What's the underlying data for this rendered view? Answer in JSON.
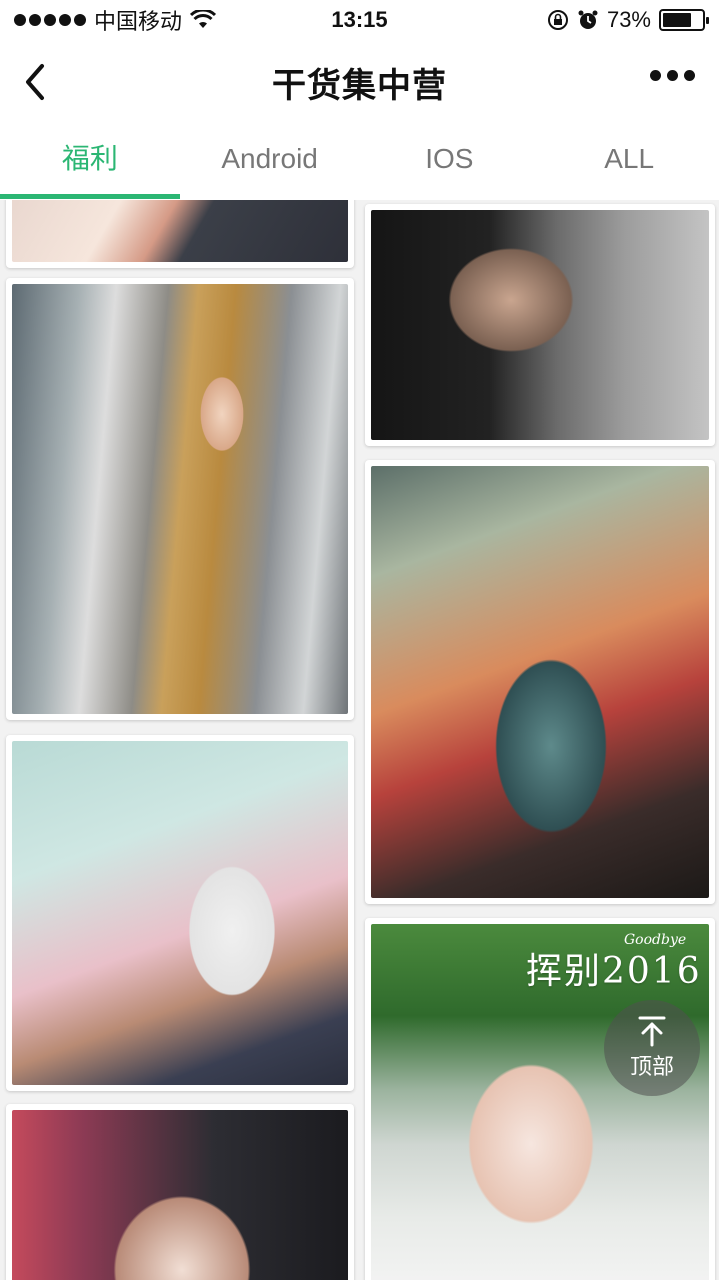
{
  "status_bar": {
    "carrier": "中国移动",
    "time": "13:15",
    "battery_percent": "73%",
    "battery_level": 0.73
  },
  "header": {
    "title": "干货集中营"
  },
  "tabs": [
    {
      "label": "福利",
      "active": true
    },
    {
      "label": "Android",
      "active": false
    },
    {
      "label": "IOS",
      "active": false
    },
    {
      "label": "ALL",
      "active": false
    }
  ],
  "feed": {
    "overlay_text": "挥别2016",
    "overlay_sub": "Goodbye"
  },
  "back_to_top": {
    "label": "顶部"
  },
  "colors": {
    "accent": "#2bb673",
    "tab_inactive": "#777777"
  }
}
